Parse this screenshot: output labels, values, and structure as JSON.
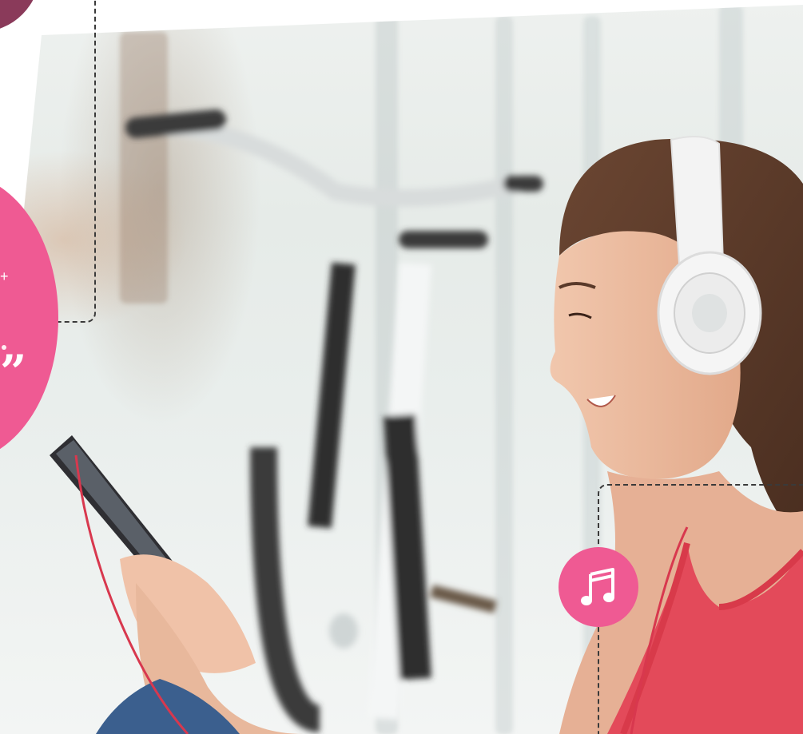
{
  "decor": {
    "quote_mark": "”",
    "plus_mark": "+"
  },
  "icons": {
    "music_badge": "music-note-icon"
  },
  "colors": {
    "accent_pink": "#ef5a93",
    "accent_plum": "#8a3a5a",
    "dashed_line": "#3a3a3a"
  }
}
